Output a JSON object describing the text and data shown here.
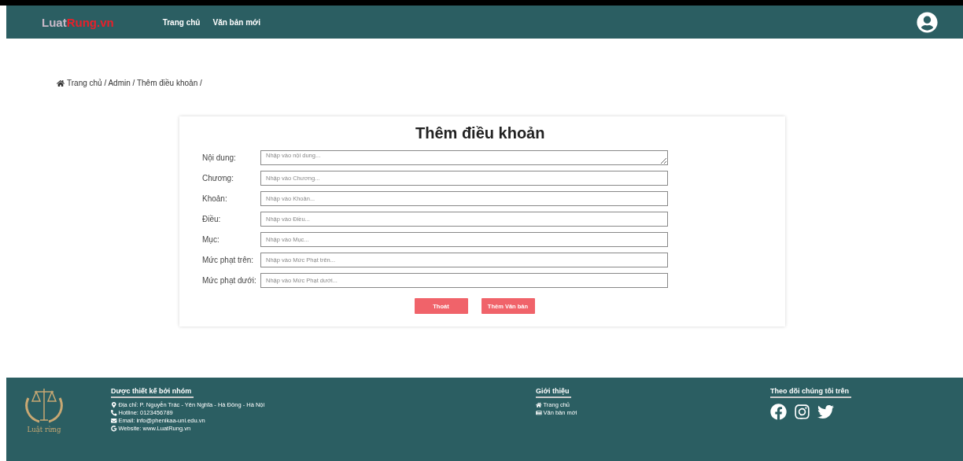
{
  "header": {
    "logo": {
      "first": "Luat",
      "second": "Rung.vn"
    },
    "nav": [
      {
        "label": "Trang chủ"
      },
      {
        "label": "Văn bản mới"
      }
    ]
  },
  "breadcrumb": {
    "text": "Trang chủ / Admin / Thêm điều khoản /"
  },
  "form": {
    "title": "Thêm điều khoản",
    "fields": [
      {
        "label": "Nội dung:",
        "placeholder": "Nhập vào nội dung...",
        "kind": "textarea"
      },
      {
        "label": "Chương:",
        "placeholder": "Nhập vào Chương...",
        "kind": "input"
      },
      {
        "label": "Khoản:",
        "placeholder": "Nhập vào Khoản...",
        "kind": "input"
      },
      {
        "label": "Điều:",
        "placeholder": "Nhập vào Điều...",
        "kind": "input"
      },
      {
        "label": "Mục:",
        "placeholder": "Nhập vào Mục...",
        "kind": "input"
      },
      {
        "label": "Mức phạt trên:",
        "placeholder": "Nhập vào Mức Phạt trên...",
        "kind": "input"
      },
      {
        "label": "Mức phạt dưới:",
        "placeholder": "Nhập vào Mức Phạt dưới...",
        "kind": "input"
      }
    ],
    "buttons": [
      "Thoát",
      "Thêm Văn bản"
    ]
  },
  "footer": {
    "brand": "Luật rừng",
    "team": {
      "title": "Dược thiết kế bởi nhóm",
      "lines": [
        {
          "kind": "pin",
          "text": "Địa chỉ: P. Nguyễn Trác - Yên Nghĩa - Hà Đông - Hà Nội"
        },
        {
          "kind": "phone",
          "text": "Hotline: 0123456789"
        },
        {
          "kind": "mail",
          "text": "Email: info@phenikaa-uni.edu.vn"
        },
        {
          "kind": "web",
          "text": "Website: www.LuatRung.vn"
        }
      ]
    },
    "about": {
      "title": "Giới thiệu",
      "links": [
        {
          "kind": "home",
          "text": "Trang chủ"
        },
        {
          "kind": "news",
          "text": "Văn bản mới"
        }
      ]
    },
    "social": {
      "title": "Theo dõi chúng tôi trên",
      "icons": [
        {
          "kind": "facebook"
        },
        {
          "kind": "instagram"
        },
        {
          "kind": "twitter"
        }
      ]
    }
  }
}
